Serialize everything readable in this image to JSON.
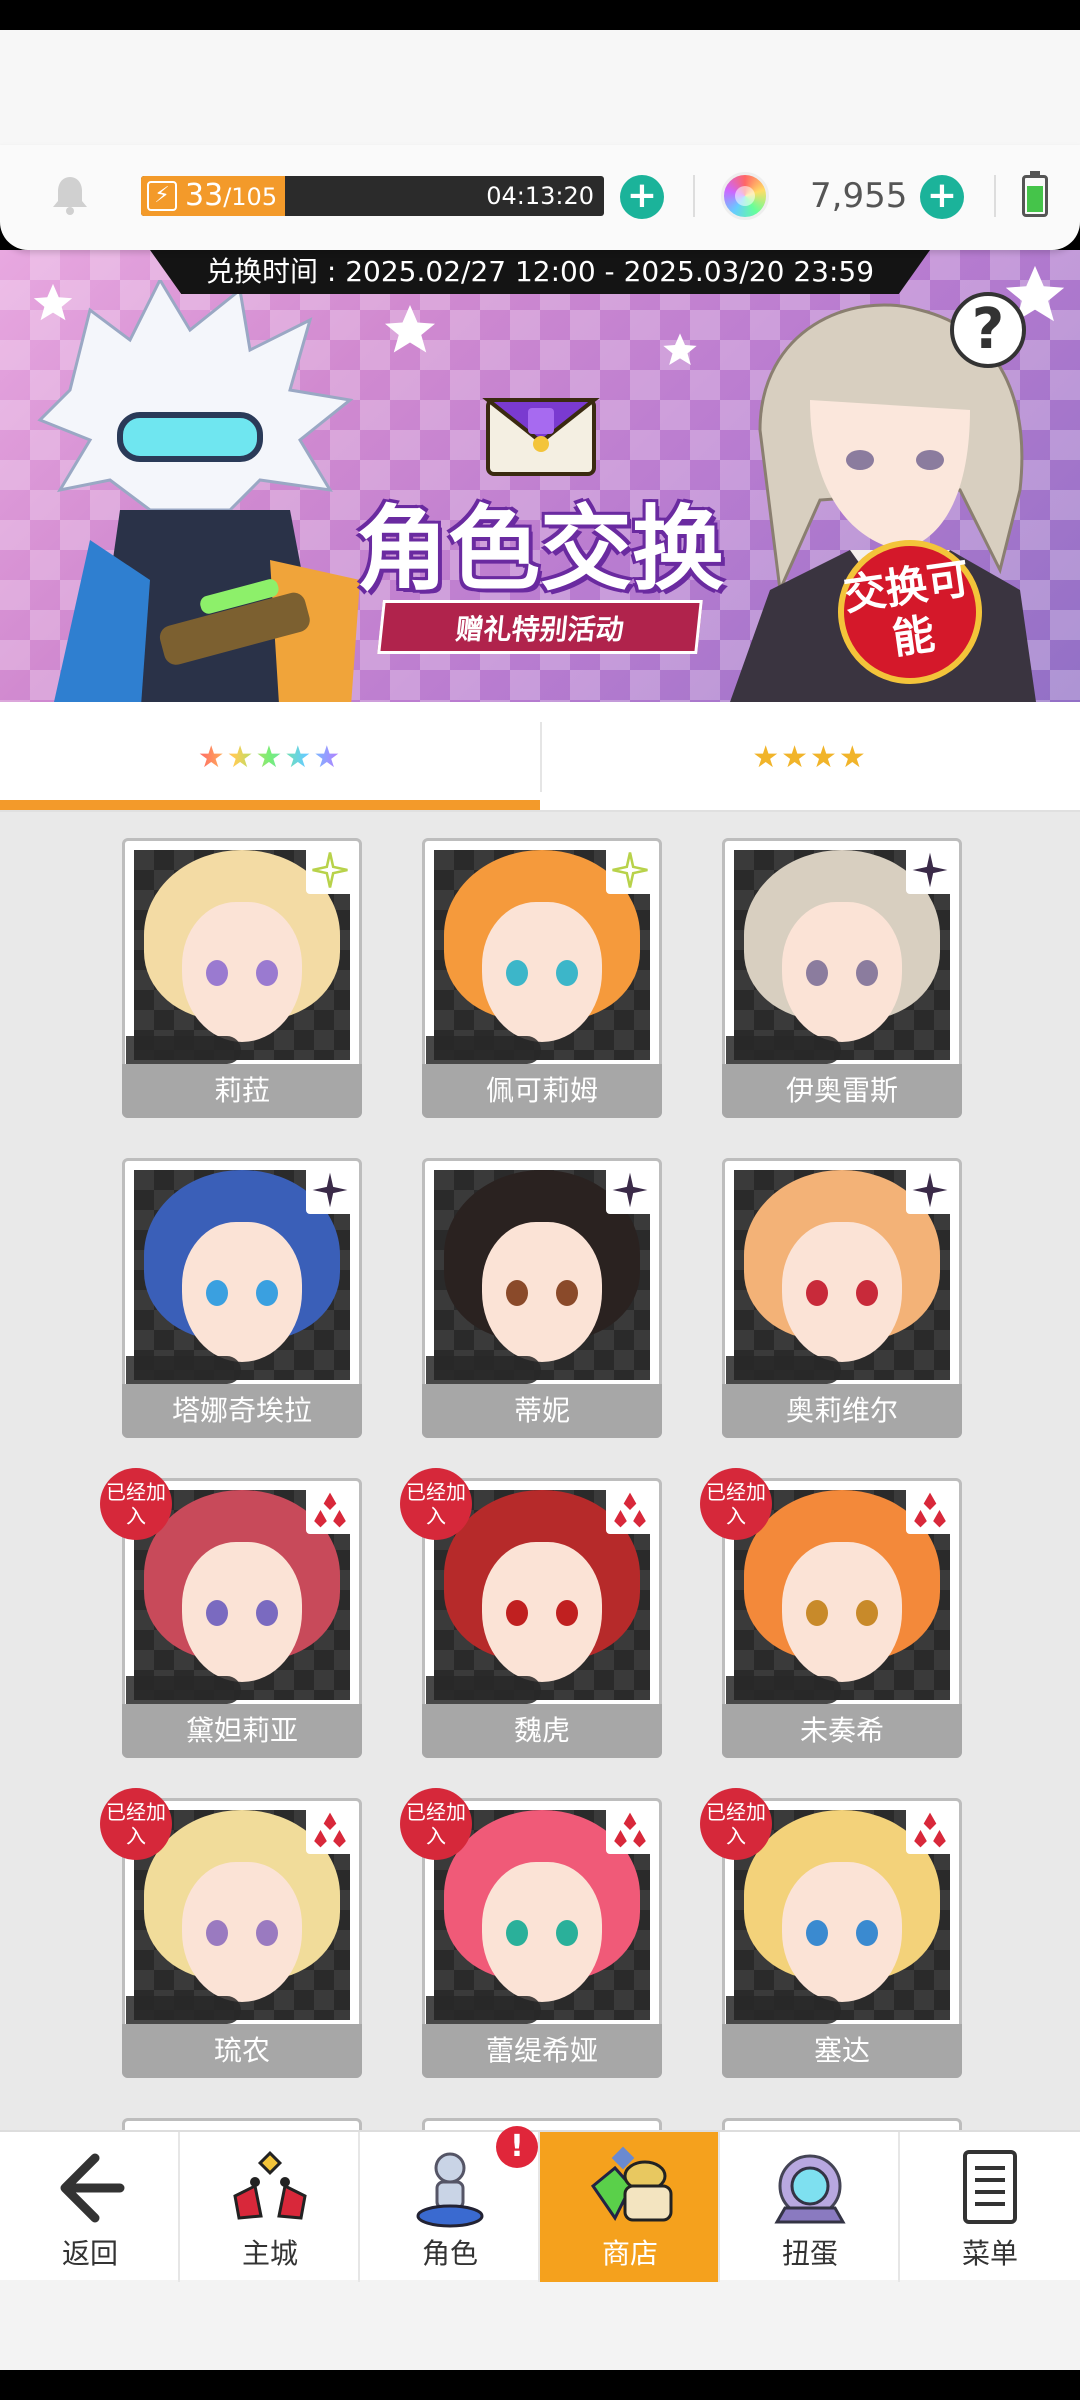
{
  "resources": {
    "stamina_current": "33",
    "stamina_max": "/105",
    "stamina_fraction": 0.31,
    "stamina_timer": "04:13:20",
    "gems": "7,955"
  },
  "banner": {
    "exchange_time": "兑换时间 : 2025.02/27 12:00 - 2025.03/20 23:59",
    "title": "角色交换",
    "subtitle": "赠礼特别活动",
    "badge": "交换可能",
    "help": "?"
  },
  "tabs": [
    {
      "label": "★★★★★",
      "active": true
    },
    {
      "label": "★★★★",
      "active": false
    }
  ],
  "cards": [
    {
      "name": "莉菈",
      "stars": "★★★★★",
      "joined": false,
      "type": "light",
      "hair": "#f3dba4",
      "eyes": "#9a7ad0"
    },
    {
      "name": "佩可莉姆",
      "stars": "★★★★★",
      "joined": false,
      "type": "light",
      "hair": "#f59a3c",
      "eyes": "#3cb6c9"
    },
    {
      "name": "伊奥雷斯",
      "stars": "★★★★★",
      "joined": false,
      "type": "dark",
      "hair": "#d8cfc0",
      "eyes": "#8b7c9e"
    },
    {
      "name": "塔娜奇埃拉",
      "stars": "★★★★★",
      "joined": false,
      "type": "dark",
      "hair": "#3a5fb8",
      "eyes": "#3aa0e0"
    },
    {
      "name": "蒂妮",
      "stars": "★★★★★",
      "joined": false,
      "type": "dark",
      "hair": "#2a2220",
      "eyes": "#8a4a2a"
    },
    {
      "name": "奥莉维尔",
      "stars": "★★★★★",
      "joined": false,
      "type": "dark",
      "hair": "#f3b277",
      "eyes": "#c82a3a"
    },
    {
      "name": "黛妲莉亚",
      "stars": "★★★★★",
      "joined": true,
      "type": "fire",
      "hair": "#c84a5a",
      "eyes": "#7a6ac0"
    },
    {
      "name": "魏虎",
      "stars": "★★★★★",
      "joined": true,
      "type": "fire",
      "hair": "#b62a2a",
      "eyes": "#c02020"
    },
    {
      "name": "未奏希",
      "stars": "★★★★★",
      "joined": true,
      "type": "fire",
      "hair": "#f3893a",
      "eyes": "#c88a2a"
    },
    {
      "name": "琉农",
      "stars": "★★★★★",
      "joined": true,
      "type": "fire",
      "hair": "#f1dc9a",
      "eyes": "#9a7ac0"
    },
    {
      "name": "蕾缇希娅",
      "stars": "★★★★★",
      "joined": true,
      "type": "fire",
      "hair": "#f05a78",
      "eyes": "#2ab09a"
    },
    {
      "name": "塞达",
      "stars": "★★★★★",
      "joined": true,
      "type": "fire",
      "hair": "#f3d27a",
      "eyes": "#3a8ad0"
    }
  ],
  "joined_label": "已经加入",
  "nav": [
    {
      "label": "返回",
      "icon": "back-arrow-icon"
    },
    {
      "label": "主城",
      "icon": "castle-icon"
    },
    {
      "label": "角色",
      "icon": "character-icon",
      "alert": "!"
    },
    {
      "label": "商店",
      "icon": "shop-icon",
      "active": true
    },
    {
      "label": "扭蛋",
      "icon": "gacha-icon"
    },
    {
      "label": "菜单",
      "icon": "menu-icon"
    }
  ],
  "colors": {
    "accent": "#f39a2a",
    "plus": "#1bb39a",
    "alert": "#e0263a",
    "name_bar": "#a7a7a7"
  }
}
